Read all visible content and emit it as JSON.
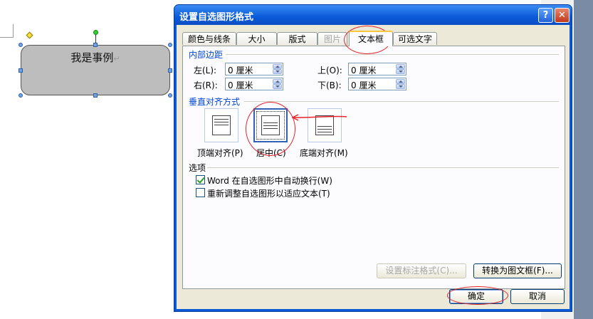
{
  "document": {
    "shape_text": "我是事例",
    "para_mark": "↵"
  },
  "dialog": {
    "title": "设置自选图形格式",
    "help_label": "?",
    "close_label": "✕",
    "tabs": [
      {
        "label": "颜色与线条",
        "state": "normal"
      },
      {
        "label": "大小",
        "state": "normal"
      },
      {
        "label": "版式",
        "state": "normal"
      },
      {
        "label": "图片",
        "state": "disabled"
      },
      {
        "label": "文本框",
        "state": "active"
      },
      {
        "label": "可选文字",
        "state": "normal"
      }
    ],
    "margins": {
      "group_label": "内部边距",
      "left_label": "左(L):",
      "left_value": "0 厘米",
      "right_label": "右(R):",
      "right_value": "0 厘米",
      "top_label": "上(O):",
      "top_value": "0 厘米",
      "bottom_label": "下(B):",
      "bottom_value": "0 厘米"
    },
    "vertical_alignment": {
      "group_label": "垂直对齐方式",
      "options": [
        {
          "label": "顶端对齐(P)",
          "selected": false
        },
        {
          "label": "居中(C)",
          "selected": true
        },
        {
          "label": "底端对齐(M)",
          "selected": false
        }
      ]
    },
    "options": {
      "group_label": "选项",
      "word_wrap_label": "Word 在自选图形中自动换行(W)",
      "word_wrap_checked": true,
      "resize_label": "重新调整自选图形以适应文本(T)",
      "resize_checked": false
    },
    "buttons": {
      "callout_format": "设置标注格式(C)...",
      "convert_frame": "转换为图文框(F)...",
      "ok": "确定",
      "cancel": "取消"
    }
  },
  "colors": {
    "title_blue": "#0a5ad8",
    "group_label": "#0046d5",
    "annotation_red": "#e8242a"
  }
}
